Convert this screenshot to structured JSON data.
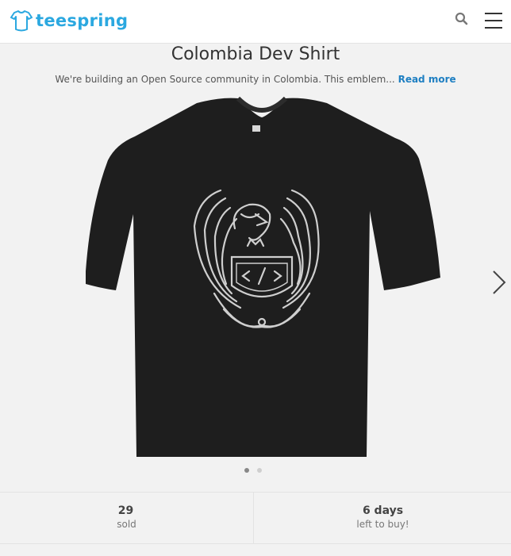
{
  "header": {
    "brand": "teespring",
    "icons": {
      "logo": "tshirt-logo-icon",
      "search": "search-icon",
      "menu": "hamburger-menu-icon"
    },
    "brand_color": "#2ba8e0"
  },
  "product": {
    "title": "Colombia Dev Shirt",
    "description": "We're building an Open Source community in Colombia. This emblem...",
    "read_more": "Read more",
    "image_icon": "tshirt-eagle-code-emblem",
    "carousel": {
      "slides": 2,
      "active_index": 0,
      "next_icon": "chevron-right-icon"
    }
  },
  "stats": {
    "sold": {
      "value": "29",
      "label": "sold"
    },
    "time_left": {
      "value": "6 days",
      "label": "left to buy!"
    }
  },
  "colors": {
    "link": "#1e7fc2",
    "shirt": "#1e1e1e",
    "background": "#f2f2f2"
  }
}
